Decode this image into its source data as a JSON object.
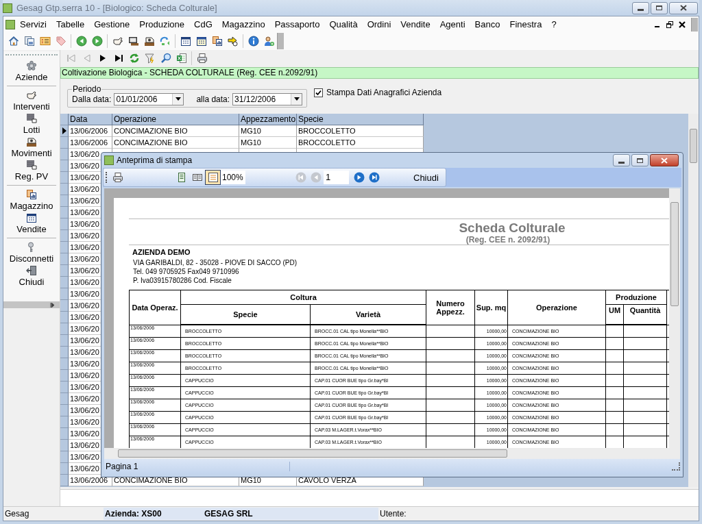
{
  "window": {
    "title": "Gesag Gtp.serra 10 - [Biologico: Scheda Colturale]"
  },
  "menu": [
    "Servizi",
    "Tabelle",
    "Gestione",
    "Produzione",
    "CdG",
    "Magazzino",
    "Passaporto",
    "Qualità",
    "Ordini",
    "Vendite",
    "Agenti",
    "Banco",
    "Finestra",
    "?"
  ],
  "sidebar": {
    "groups": [
      [
        "Aziende"
      ],
      [
        "Interventi",
        "Lotti",
        "Movimenti",
        "Reg. PV"
      ],
      [
        "Magazzino",
        "Vendite"
      ],
      [
        "Disconnetti",
        "Chiudi"
      ]
    ]
  },
  "record_nav": [
    {
      "kind": "first",
      "disabled": true
    },
    {
      "kind": "previous",
      "disabled": true
    },
    {
      "kind": "next",
      "disabled": false
    },
    {
      "kind": "last",
      "disabled": false
    }
  ],
  "banner": "Coltivazione Biologica - SCHEDA COLTURALE (Reg. CEE n.2092/91)",
  "period": {
    "title": "Periodo",
    "from_label": "Dalla data:",
    "from": "01/01/2006",
    "to_label": "alla data:",
    "to": "31/12/2006"
  },
  "print_company": {
    "label": "Stampa Dati Anagrafici Azienda",
    "checked": true
  },
  "grid": {
    "columns": [
      "Data",
      "Operazione",
      "Appezzamento",
      "Specie"
    ],
    "rows": [
      {
        "date": "13/06/2006",
        "operation": "CONCIMAZIONE BIO",
        "plot": "MG10",
        "species": "BROCCOLETTO",
        "selected": true
      },
      {
        "date": "13/06/2006",
        "operation": "CONCIMAZIONE BIO",
        "plot": "MG10",
        "species": "BROCCOLETTO",
        "selected": false
      },
      {
        "date": "13/06/20",
        "selected": false
      },
      {
        "date": "13/06/20",
        "selected": false
      },
      {
        "date": "13/06/20",
        "selected": false
      },
      {
        "date": "13/06/20",
        "selected": false
      },
      {
        "date": "13/06/20",
        "selected": false
      },
      {
        "date": "13/06/20",
        "selected": false
      },
      {
        "date": "13/06/20",
        "selected": false
      },
      {
        "date": "13/06/20",
        "selected": false
      },
      {
        "date": "13/06/20",
        "selected": false
      },
      {
        "date": "13/06/20",
        "selected": false
      },
      {
        "date": "13/06/20",
        "selected": false
      },
      {
        "date": "13/06/20",
        "selected": false
      },
      {
        "date": "13/06/20",
        "selected": false
      },
      {
        "date": "13/06/20",
        "selected": false
      },
      {
        "date": "13/06/20",
        "selected": false
      },
      {
        "date": "13/06/20",
        "selected": false
      },
      {
        "date": "13/06/20",
        "selected": false
      },
      {
        "date": "13/06/20",
        "selected": false
      },
      {
        "date": "13/06/20",
        "selected": false
      },
      {
        "date": "13/06/20",
        "selected": false
      },
      {
        "date": "13/06/20",
        "selected": false
      },
      {
        "date": "13/06/20",
        "selected": false
      },
      {
        "date": "13/06/20",
        "selected": false
      },
      {
        "date": "13/06/20",
        "selected": false
      },
      {
        "date": "13/06/20",
        "selected": false
      },
      {
        "date": "13/06/20",
        "selected": false
      },
      {
        "date": "13/06/20",
        "selected": false
      },
      {
        "date": "13/06/20",
        "selected": false
      },
      {
        "date": "13/06/2006",
        "operation": "CONCIMAZIONE BIO",
        "plot": "MG10",
        "species": "CAVOLO VERZA",
        "selected": false
      }
    ]
  },
  "preview": {
    "title": "Anteprima di stampa",
    "zoom": "100%",
    "page": "1",
    "close": "Chiudi",
    "view_modes": [
      {
        "kind": "page",
        "selected": false
      },
      {
        "kind": "two-pages",
        "selected": false
      },
      {
        "kind": "page-width",
        "selected": true
      }
    ],
    "page_nav": [
      {
        "kind": "first",
        "disabled": true
      },
      {
        "kind": "previous",
        "disabled": true
      },
      {
        "kind": "next",
        "disabled": false
      },
      {
        "kind": "last",
        "disabled": false
      }
    ],
    "report": {
      "title": "Scheda Colturale",
      "subtitle": "(Reg. CEE n. 2092/91)",
      "company": "AZIENDA DEMO",
      "address": [
        "VIA GARIBALDI, 82 - 35028 - PIOVE DI SACCO (PD)",
        "Tel. 049 9705925   Fax049 9710996",
        "P. Iva03915780286 Cod. Fiscale"
      ],
      "headers": {
        "date": "Data Operaz.",
        "crop": "Coltura",
        "species": "Specie",
        "variety": "Varietà",
        "plot": "Numero Appezz.",
        "area": "Sup. mq",
        "operation": "Operazione",
        "production": "Produzione",
        "unit": "UM",
        "quantity": "Quantità"
      },
      "rows": [
        {
          "date": "13/06/2006",
          "species": "BROCCOLETTO",
          "variety": "BROCC.01 CAL tipo Monella**BIO",
          "area": "10000,00",
          "operation": "CONCIMAZIONE BIO"
        },
        {
          "date": "13/06/2006",
          "species": "BROCCOLETTO",
          "variety": "BROCC.01 CAL tipo Monella**BIO",
          "area": "10000,00",
          "operation": "CONCIMAZIONE BIO"
        },
        {
          "date": "13/06/2006",
          "species": "BROCCOLETTO",
          "variety": "BROCC.01 CAL tipo Monella**BIO",
          "area": "10000,00",
          "operation": "CONCIMAZIONE BIO"
        },
        {
          "date": "13/06/2006",
          "species": "BROCCOLETTO",
          "variety": "BROCC.01 CAL tipo Monella**BIO",
          "area": "10000,00",
          "operation": "CONCIMAZIONE BIO"
        },
        {
          "date": "13/06/2006",
          "species": "CAPPUCCIO",
          "variety": "CAP.01 CUOR BUE tipo Gr.bay*BI",
          "area": "10000,00",
          "operation": "CONCIMAZIONE BIO"
        },
        {
          "date": "13/06/2006",
          "species": "CAPPUCCIO",
          "variety": "CAP.01 CUOR BUE tipo Gr.bay*BI",
          "area": "10000,00",
          "operation": "CONCIMAZIONE BIO"
        },
        {
          "date": "13/06/2006",
          "species": "CAPPUCCIO",
          "variety": "CAP.01 CUOR BUE tipo Gr.bay*BI",
          "area": "10000,00",
          "operation": "CONCIMAZIONE BIO"
        },
        {
          "date": "13/06/2006",
          "species": "CAPPUCCIO",
          "variety": "CAP.01 CUOR BUE tipo Gr.bay*BI",
          "area": "10000,00",
          "operation": "CONCIMAZIONE BIO"
        },
        {
          "date": "13/06/2006",
          "species": "CAPPUCCIO",
          "variety": "CAP.03 M.LAGER.t.Vorax**BIO",
          "area": "10000,00",
          "operation": "CONCIMAZIONE BIO"
        },
        {
          "date": "13/06/2006",
          "species": "CAPPUCCIO",
          "variety": "CAP.03 M.LAGER.t.Vorax**BIO",
          "area": "10000,00",
          "operation": "CONCIMAZIONE BIO"
        }
      ]
    },
    "status": "Pagina 1"
  },
  "status_bar": {
    "app": "Gesag",
    "company": "Azienda: XS00",
    "company_name": "GESAG SRL",
    "user": "Utente:"
  }
}
